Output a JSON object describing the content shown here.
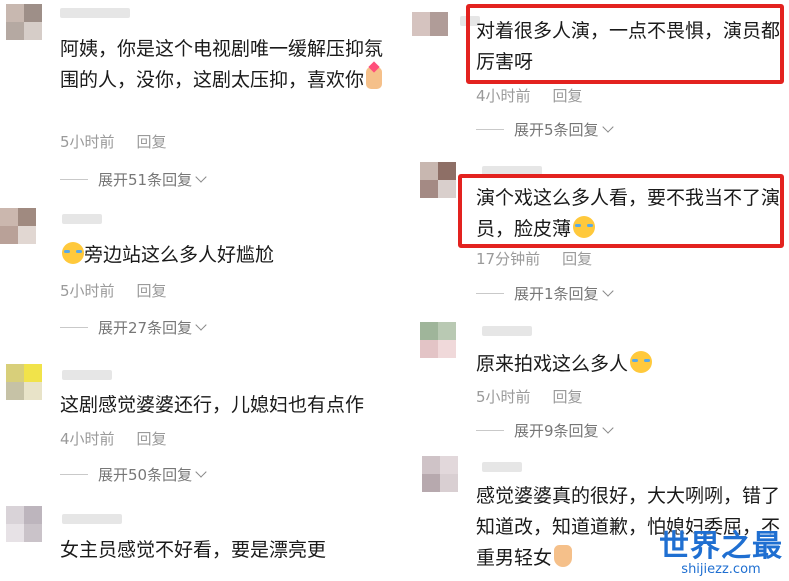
{
  "left_comments": [
    {
      "text": "阿姨，你是这个电视剧唯一缓解压抑氛围的人，没你，这剧太压抑，喜欢你",
      "emoji": "heart-hand-emoji",
      "time": "5小时前",
      "reply": "回复",
      "expand": "展开51条回复"
    },
    {
      "text": "旁边站这么多人好尴尬",
      "emoji": "laughing-crying-emoji",
      "time": "5小时前",
      "reply": "回复",
      "expand": "展开27条回复"
    },
    {
      "text": "这剧感觉婆婆还行，儿媳妇也有点作",
      "time": "4小时前",
      "reply": "回复",
      "expand": "展开50条回复"
    },
    {
      "text": "女主员感觉不好看，要是漂亮更"
    }
  ],
  "right_comments": [
    {
      "text": "对着很多人演，一点不畏惧，演员都厉害呀",
      "time": "4小时前",
      "reply": "回复",
      "expand": "展开5条回复",
      "highlighted": true
    },
    {
      "text": "演个戏这么多人看，要不我当不了演员，脸皮薄",
      "emoji": "laughing-crying-emoji",
      "time": "17分钟前",
      "reply": "回复",
      "expand": "展开1条回复",
      "highlighted": true
    },
    {
      "text": "原来拍戏这么多人",
      "emoji": "tears-emoji",
      "time": "5小时前",
      "reply": "回复",
      "expand": "展开9条回复"
    },
    {
      "text": "感觉婆婆真的很好，大大咧咧，错了知道改，知道道歉，怕媳妇委屈，不重男轻女",
      "emoji": "thumbs-up-emoji"
    }
  ],
  "highlight_color": "#e3221f",
  "watermark": {
    "title": "世界之最",
    "url": "shijiezz.com"
  }
}
